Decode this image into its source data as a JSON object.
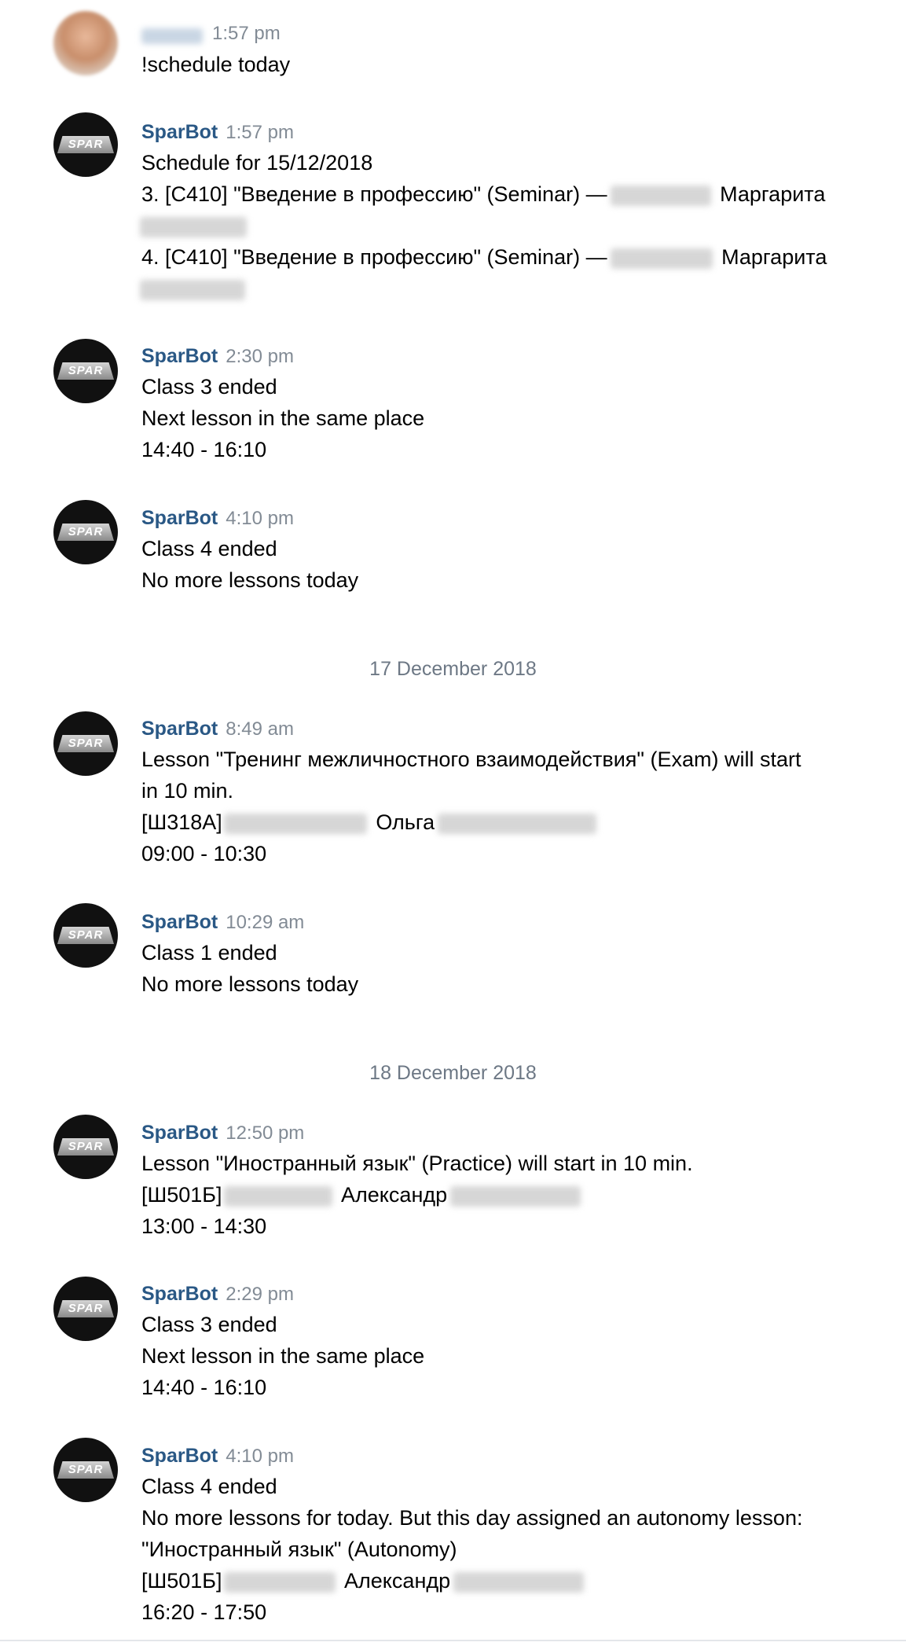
{
  "messages": [
    {
      "author": "",
      "time": "1:57 pm",
      "lines": [
        "!schedule today"
      ]
    },
    {
      "author": "SparBot",
      "time": "1:57 pm",
      "lines": [
        "Schedule for 15/12/2018",
        "3. [C410] \"Введение в профессию\" (Seminar) —",
        "Маргарита",
        "4. [C410] \"Введение в профессию\" (Seminar) —",
        "Маргарита"
      ]
    },
    {
      "author": "SparBot",
      "time": "2:30 pm",
      "lines": [
        "Class 3 ended",
        "Next lesson in the same place",
        "14:40 - 16:10"
      ]
    },
    {
      "author": "SparBot",
      "time": "4:10 pm",
      "lines": [
        "Class 4 ended",
        "No more lessons today"
      ]
    },
    {
      "author": "SparBot",
      "time": "8:49 am",
      "lines": [
        "Lesson \"Тренинг межличностного взаимодействия\" (Exam) will start",
        "in 10 min.",
        "[Ш318А]",
        "Ольга",
        "09:00 - 10:30"
      ]
    },
    {
      "author": "SparBot",
      "time": "10:29 am",
      "lines": [
        "Class 1 ended",
        "No more lessons today"
      ]
    },
    {
      "author": "SparBot",
      "time": "12:50 pm",
      "lines": [
        "Lesson \"Иностранный язык\" (Practice) will start in 10 min.",
        "[Ш501Б]",
        "Александр",
        "13:00 - 14:30"
      ]
    },
    {
      "author": "SparBot",
      "time": "2:29 pm",
      "lines": [
        "Class 3 ended",
        "Next lesson in the same place",
        "14:40 - 16:10"
      ]
    },
    {
      "author": "SparBot",
      "time": "4:10 pm",
      "lines": [
        "Class 4 ended",
        "No more lessons for today. But this day assigned an autonomy lesson:",
        "\"Иностранный язык\" (Autonomy)",
        "[Ш501Б]",
        "Александр",
        "16:20 - 17:50"
      ]
    }
  ],
  "date_separators": [
    "17 December 2018",
    "18 December 2018"
  ],
  "avatar_badge": "SPAR"
}
